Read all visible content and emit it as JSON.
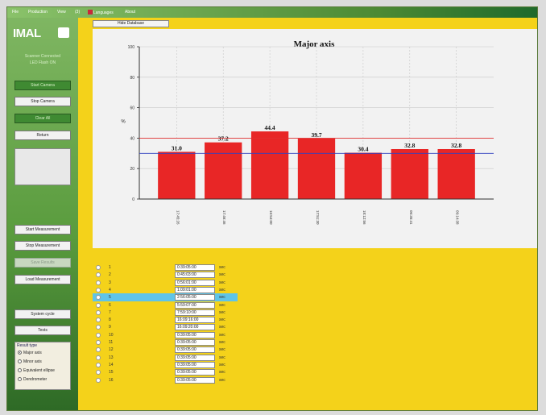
{
  "menu": {
    "items": [
      "File",
      "Production",
      "View",
      "(3)",
      "Languages",
      "About"
    ]
  },
  "sidebar": {
    "logo_text": "IMAL",
    "status_line1": "Scanner Connected",
    "status_line2": "LED Flash ON",
    "buttons": {
      "start_camera": "Start Camera",
      "stop_camera": "Stop Camera",
      "clear_all": "Clear All",
      "return": "Return",
      "start_measurement": "Start Measurement",
      "stop_measurement": "Stop Measurement",
      "save_results": "Save Results",
      "load_measurement": "Load Measurement",
      "system_cycle": "System cycle",
      "tests": "Tests"
    },
    "result_type": {
      "title": "Result type",
      "options": [
        "Major axis",
        "Minor axis",
        "Equivalent ellipse",
        "Dendrometer"
      ],
      "selected": "Major axis"
    }
  },
  "hide_database_label": "Hide Database",
  "chart_data": {
    "type": "bar",
    "title": "Major axis",
    "ylabel": "%",
    "ylim": [
      0,
      100
    ],
    "yticks": [
      0,
      20,
      40,
      60,
      80,
      100
    ],
    "categories": [
      "17:45:26",
      "17:46:46",
      "16:54:00",
      "17:51:30",
      "18:12:56",
      "06:35:41",
      "09:14:38"
    ],
    "values": [
      31.0,
      37.2,
      44.4,
      39.7,
      30.4,
      32.8,
      32.8
    ],
    "value_labels": [
      "31.0",
      "37.2",
      "44.4",
      "39.7",
      "30.4",
      "32.8",
      "32.8"
    ],
    "ref_lines": [
      {
        "value": 40,
        "color": "#e03030"
      },
      {
        "value": 30,
        "color": "#3040c0"
      }
    ],
    "bar_color": "#e82626",
    "grid": true
  },
  "records": [
    {
      "num": "1",
      "time": "0:39:05:00",
      "unit": "sec"
    },
    {
      "num": "2",
      "time": "0:45:03:00",
      "unit": "sec"
    },
    {
      "num": "3",
      "time": "0:56:01:00",
      "unit": "sec"
    },
    {
      "num": "4",
      "time": "1:09:01:00",
      "unit": "sec"
    },
    {
      "num": "5",
      "time": "2:56:05:00",
      "unit": "sec"
    },
    {
      "num": "6",
      "time": "5:59:07:00",
      "unit": "sec"
    },
    {
      "num": "7",
      "time": "7:59:10:00",
      "unit": "sec"
    },
    {
      "num": "8",
      "time": "16:09:16:00",
      "unit": "sec"
    },
    {
      "num": "9",
      "time": "16:09:20:00",
      "unit": "sec"
    },
    {
      "num": "10",
      "time": "0:39:05:00",
      "unit": "sec"
    },
    {
      "num": "11",
      "time": "0:39:05:00",
      "unit": "sec"
    },
    {
      "num": "12",
      "time": "0:39:05:00",
      "unit": "sec"
    },
    {
      "num": "13",
      "time": "0:39:05:00",
      "unit": "sec"
    },
    {
      "num": "14",
      "time": "0:39:05:00",
      "unit": "sec"
    },
    {
      "num": "15",
      "time": "0:39:05:00",
      "unit": "sec"
    },
    {
      "num": "16",
      "time": "0:39:05:00",
      "unit": "sec"
    }
  ],
  "selected_record": "5"
}
